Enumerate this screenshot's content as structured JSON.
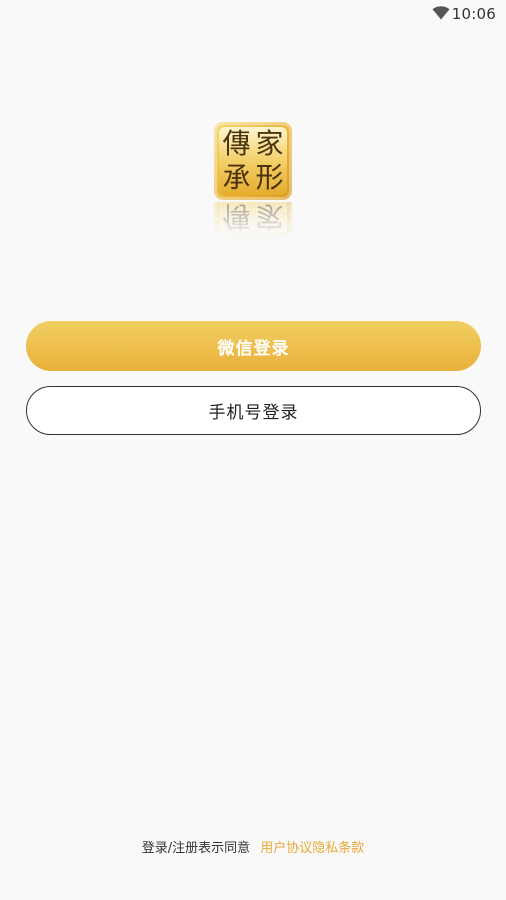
{
  "status_bar": {
    "time": "10:06",
    "wifi_icon": "wifi-icon"
  },
  "logo": {
    "glyphs": [
      "傳",
      "家",
      "承",
      "形"
    ],
    "icon": "app-logo"
  },
  "buttons": {
    "wechat_login": "微信登录",
    "phone_login": "手机号登录"
  },
  "agreement": {
    "prefix": "登录/注册表示同意",
    "link": "用户协议隐私条款"
  },
  "colors": {
    "background": "#f9f9f9",
    "accent": "#eab03a",
    "link": "#e9a937"
  }
}
